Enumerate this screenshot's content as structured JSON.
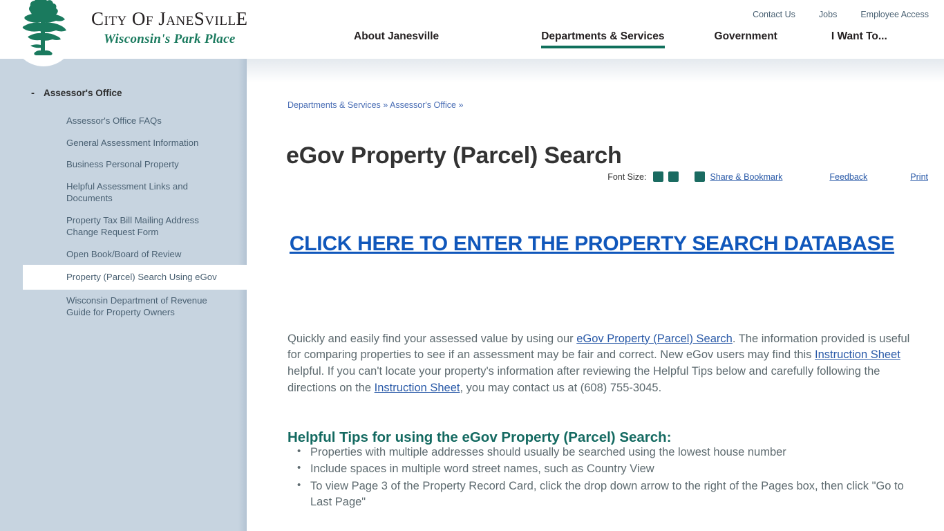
{
  "brand": {
    "title": "City Of JaneSvillE",
    "tagline": "Wisconsin's Park Place",
    "logo_icon": "green-tree-logo"
  },
  "utility_nav": [
    {
      "label": "Contact Us"
    },
    {
      "label": "Jobs"
    },
    {
      "label": "Employee Access"
    }
  ],
  "main_nav": [
    {
      "label": "About Janesville",
      "active": false
    },
    {
      "label": "Departments & Services",
      "active": true
    },
    {
      "label": "Government",
      "active": false
    },
    {
      "label": "I Want To...",
      "active": false
    }
  ],
  "sidebar": {
    "toggle_icon": "minus-icon",
    "toggle_symbol": "-",
    "section_label": "Assessor's Office",
    "items": [
      {
        "label": "Assessor's Office FAQs",
        "selected": false
      },
      {
        "label": "General Assessment Information",
        "selected": false
      },
      {
        "label": "Business Personal Property",
        "selected": false
      },
      {
        "label": "Helpful Assessment Links and Documents",
        "selected": false
      },
      {
        "label": "Property Tax Bill Mailing Address Change Request Form",
        "selected": false
      },
      {
        "label": "Open Book/Board of Review",
        "selected": false
      },
      {
        "label": "Property (Parcel) Search Using eGov",
        "selected": true
      },
      {
        "label": "Wisconsin Department of Revenue Guide for Property Owners",
        "selected": false
      }
    ]
  },
  "breadcrumb": {
    "items": [
      {
        "label": "Departments & Services"
      },
      {
        "label": "Assessor's Office"
      }
    ],
    "separator": "»",
    "trailing": "»"
  },
  "page": {
    "title": "eGov Property (Parcel) Search"
  },
  "toolbar": {
    "font_size_label": "Font Size:",
    "font_size_small_icon": "font-size-decrease-icon",
    "font_size_large_icon": "font-size-increase-icon",
    "share_icon": "share-icon",
    "share_label": "Share & Bookmark",
    "feedback_label": "Feedback",
    "print_label": "Print"
  },
  "main": {
    "hero_link": "CLICK HERE TO ENTER THE PROPERTY SEARCH DATABASE",
    "paragraph": {
      "p1": "Quickly and easily find your assessed value by using our ",
      "link1": "eGov Property (Parcel) Search",
      "p2": ". The information provided is useful for comparing properties to see if an assessment may be fair and correct. New eGov users may find this ",
      "link2": "Instruction Sheet",
      "p3": " helpful. If you can't locate your property's information after reviewing the Helpful Tips below and carefully following the directions on the ",
      "link3": "Instruction Sheet",
      "p4": ", you may contact us at (608) 755-3045."
    },
    "tips_heading": "Helpful Tips for using the eGov Property (Parcel) Search:",
    "tips": [
      "Properties with multiple addresses should usually be searched using the lowest house number",
      "Include spaces in multiple word street names, such as Country View",
      "To view Page 3 of the Property Record Card, click the drop down arrow to the right of the Pages box, then click \"Go to Last Page\""
    ]
  },
  "colors": {
    "brand_green": "#1a7a5e",
    "nav_active_underline": "#10705c",
    "sidebar_bg": "#c7d4e0",
    "link_blue": "#2a5aa8",
    "hero_blue": "#1057bb",
    "heading_teal": "#146a61",
    "body_text": "#5d6a6f",
    "icon_teal": "#1a6b61"
  }
}
